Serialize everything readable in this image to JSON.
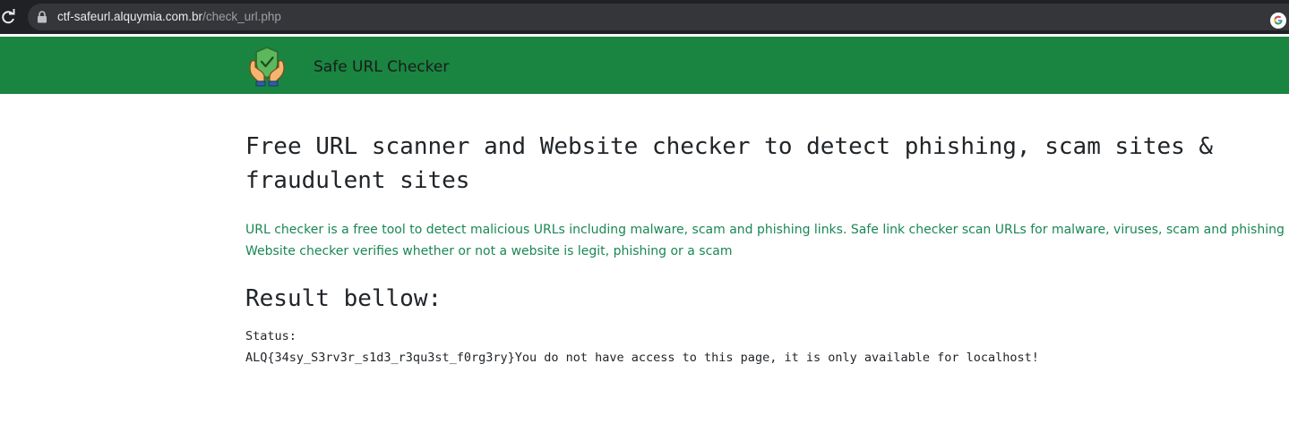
{
  "browser": {
    "url_host": "ctf-safeurl.alquymia.com.br",
    "url_path": "/check_url.php",
    "icons": [
      "reload-icon",
      "lock-icon",
      "google-icon",
      "translate-icon"
    ]
  },
  "navbar": {
    "brand": "Safe URL Checker",
    "logo_icon": "shield-hands-icon",
    "background": "#198540"
  },
  "main": {
    "title": "Free URL scanner and Website checker to detect phishing, scam sites & fraudulent sites",
    "description_line1": "URL checker is a free tool to detect malicious URLs including malware, scam and phishing links. Safe link checker scan URLs for malware, viruses, scam and phishing links.",
    "description_line2": "Website checker verifies whether or not a website is legit, phishing or a scam",
    "result_heading": "Result bellow:",
    "status_label": "Status:",
    "status_value": "ALQ{34sy_S3rv3r_s1d3_r3qu3st_f0rg3ry}You do not have access to this page, it is only available for localhost!"
  },
  "colors": {
    "navbar_green": "#198540",
    "description_green": "#198754",
    "text_dark": "#212529",
    "browser_dark": "#202124"
  }
}
